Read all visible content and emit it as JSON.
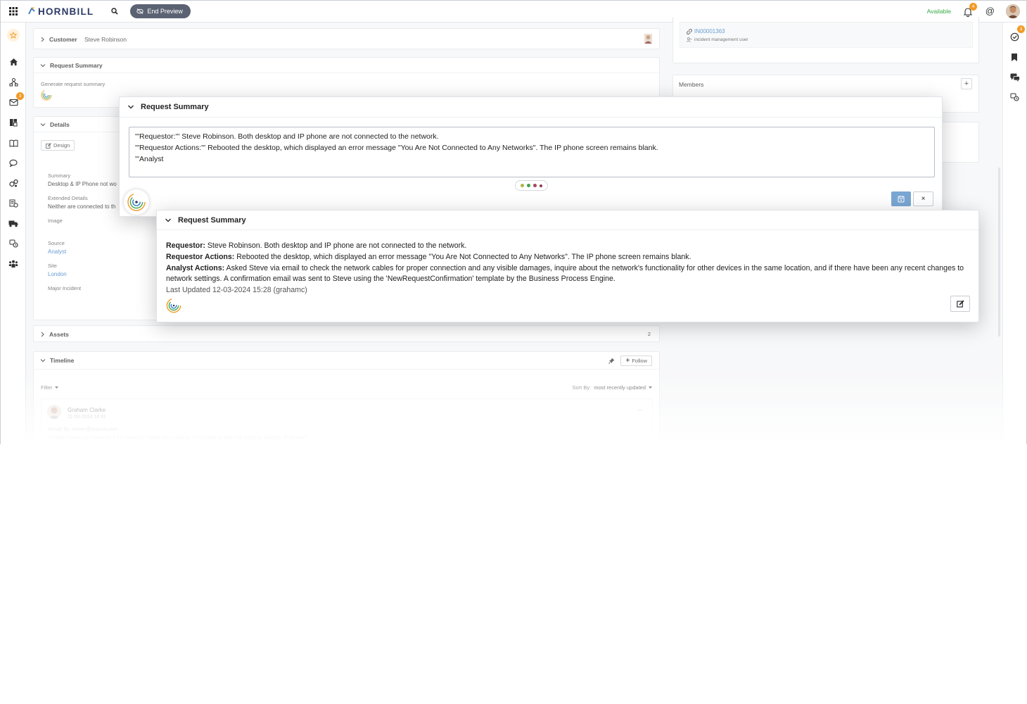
{
  "topbar": {
    "logo_text": "HORNBILL",
    "end_preview_label": "End Preview",
    "availability": "Available",
    "notification_count": "4",
    "at_symbol": "@"
  },
  "leftnav": {
    "inbox_badge": "3",
    "items": [
      "star-icon",
      "home-icon",
      "hierarchy-icon",
      "inbox-icon",
      "dashboard-icon",
      "book-icon",
      "chat-icon",
      "cogs-icon",
      "request-icon",
      "truck-icon",
      "service-icon",
      "people-icon"
    ]
  },
  "rightnav": {
    "tasks_badge": "3",
    "items": [
      "check-circle-icon",
      "bookmark-icon",
      "comments-icon",
      "service-icon"
    ]
  },
  "customer": {
    "label": "Customer",
    "name": "Steve Robinson"
  },
  "request_summary_panel": {
    "title": "Request Summary",
    "generate_label": "Generate request summary"
  },
  "details": {
    "title": "Details",
    "design_button": "Design",
    "fields": [
      {
        "label": "Summary",
        "value": "Desktop & IP Phone not wo"
      },
      {
        "label": "Extended Details",
        "value": "Neither are connected to th"
      },
      {
        "label": "Image",
        "value": ""
      },
      {
        "label": "Source",
        "value": "Analyst"
      },
      {
        "label": "Site",
        "value": "London"
      },
      {
        "label": "Major Incident",
        "value": ""
      }
    ]
  },
  "assets": {
    "title": "Assets",
    "count": "2"
  },
  "timeline": {
    "title": "Timeline",
    "follow_button": "Follow",
    "filter_label": "Filter",
    "sort_label": "Sort By:",
    "sort_value": "most recently updated",
    "entry": {
      "author": "Graham Clarke",
      "date": "11-03-2024 14:31",
      "email_to": "Email To: stever@arescs.com",
      "details": "Details: Have you checked if the network cables are properly connected to both the desktop and the IP phone?",
      "more": "..."
    }
  },
  "linked": {
    "reference": "IN00001363",
    "role": "incident management user"
  },
  "members": {
    "title": "Members"
  },
  "edit_dialog": {
    "title": "Request Summary",
    "lines": [
      "'''Requestor:''' Steve Robinson. Both desktop and IP phone are not connected to the network.",
      "'''Requestor Actions:''' Rebooted the desktop, which displayed an error message \"You Are Not Connected to Any Networks\". The IP phone screen remains blank.",
      "'''Analyst"
    ],
    "dot_colors": [
      "#a9b54a",
      "#3fa64b",
      "#a34a5a",
      "#8c3b54"
    ],
    "close_symbol": "×"
  },
  "summary_card": {
    "title": "Request Summary",
    "requestor_label": "Requestor:",
    "requestor_text": " Steve Robinson. Both desktop and IP phone are not connected to the network.",
    "requestor_actions_label": "Requestor Actions:",
    "requestor_actions_text": " Rebooted the desktop, which displayed an error message \"You Are Not Connected to Any Networks\". The IP phone screen remains blank.",
    "analyst_actions_label": "Analyst Actions:",
    "analyst_actions_text": " Asked Steve via email to check the network cables for proper connection and any visible damages, inquire about the network's functionality for other devices in the same location, and if there have been any recent changes to network settings. A confirmation email was sent to Steve using the 'NewRequestConfirmation' template by the Business Process Engine.",
    "last_updated": "Last Updated 12-03-2024 15:28 (grahamc)"
  },
  "colors": {
    "brand": "#2b3a67",
    "accent_blue": "#2f78c4",
    "badge_orange": "#f29a26",
    "available_green": "#35a845"
  }
}
